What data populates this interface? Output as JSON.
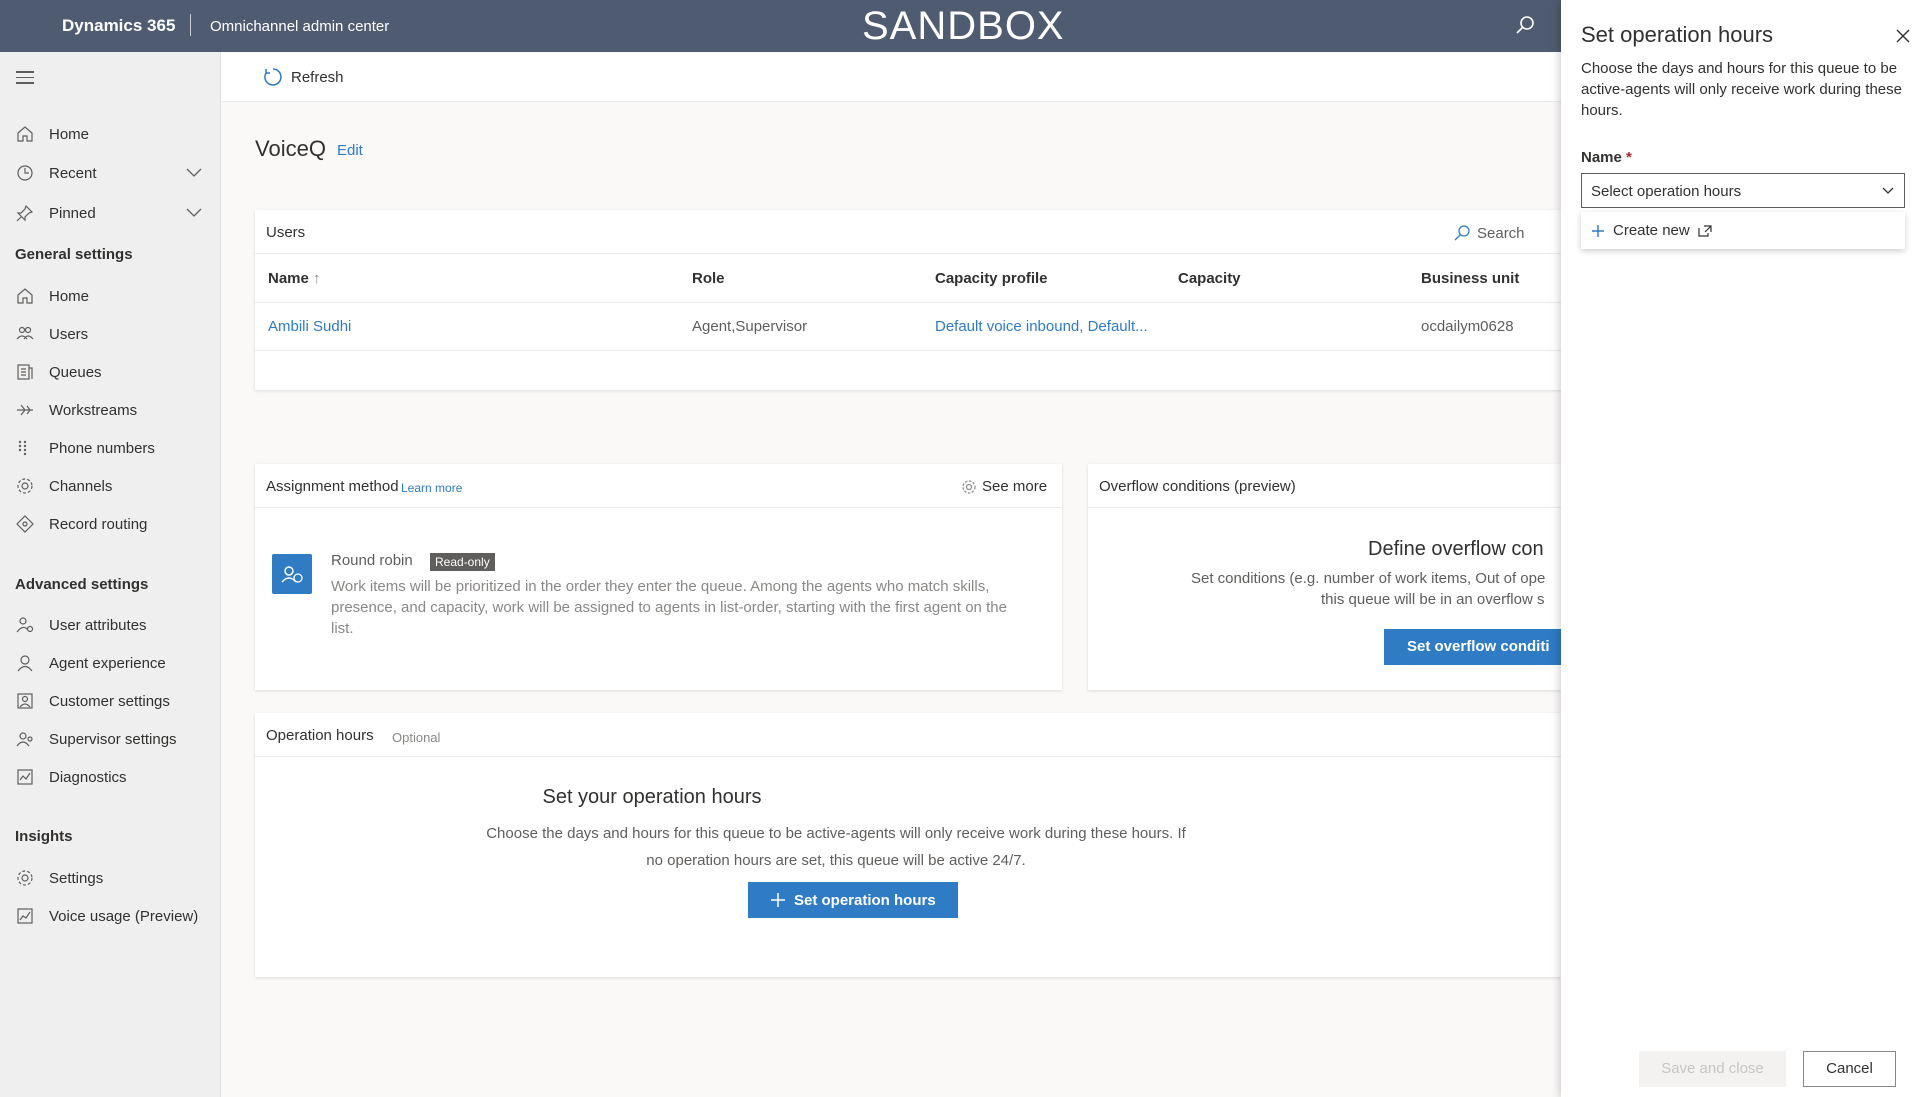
{
  "header": {
    "brand": "Dynamics 365",
    "app_name": "Omnichannel admin center",
    "environment": "SANDBOX"
  },
  "nav": {
    "top_items": [
      {
        "label": "Home",
        "icon": "home-icon"
      },
      {
        "label": "Recent",
        "icon": "clock-icon",
        "expandable": true
      },
      {
        "label": "Pinned",
        "icon": "pin-icon",
        "expandable": true
      }
    ],
    "general_settings_title": "General settings",
    "general_items": [
      {
        "label": "Home",
        "icon": "home-icon"
      },
      {
        "label": "Users",
        "icon": "users-icon"
      },
      {
        "label": "Queues",
        "icon": "queue-icon"
      },
      {
        "label": "Workstreams",
        "icon": "workstream-icon"
      },
      {
        "label": "Phone numbers",
        "icon": "dialpad-icon"
      },
      {
        "label": "Channels",
        "icon": "channel-gear-icon"
      },
      {
        "label": "Record routing",
        "icon": "routing-icon"
      }
    ],
    "advanced_settings_title": "Advanced settings",
    "advanced_items": [
      {
        "label": "User attributes",
        "icon": "user-attributes-icon"
      },
      {
        "label": "Agent experience",
        "icon": "agent-icon"
      },
      {
        "label": "Customer settings",
        "icon": "customer-icon"
      },
      {
        "label": "Supervisor settings",
        "icon": "supervisor-icon"
      },
      {
        "label": "Diagnostics",
        "icon": "diagnostics-icon"
      }
    ],
    "insights_title": "Insights",
    "insights_items": [
      {
        "label": "Settings",
        "icon": "settings-gear-icon"
      },
      {
        "label": "Voice usage (Preview)",
        "icon": "chart-icon"
      }
    ]
  },
  "commandbar": {
    "refresh_label": "Refresh"
  },
  "page": {
    "title": "VoiceQ",
    "edit_label": "Edit"
  },
  "users_card": {
    "title": "Users",
    "search_placeholder": "Search",
    "columns": [
      "Name",
      "Role",
      "Capacity profile",
      "Capacity",
      "Business unit"
    ],
    "sort_indicator": "↑",
    "rows": [
      {
        "name": "Ambili Sudhi",
        "role": "Agent,Supervisor",
        "capacity_profile": "Default voice inbound, Default...",
        "capacity": "",
        "business_unit": "ocdailym0628"
      }
    ]
  },
  "assignment_card": {
    "title": "Assignment method",
    "learn_more": "Learn more",
    "see_more": "See more",
    "method_name": "Round robin",
    "badge": "Read-only",
    "description": "Work items will be prioritized in the order they enter the queue. Among the agents who match skills, presence, and capacity, work will be assigned to agents in list-order, starting with the first agent on the list."
  },
  "overflow_card": {
    "title": "Overflow conditions (preview)",
    "heading": "Define overflow con",
    "desc_line1": "Set conditions (e.g. number of work items, Out of ope",
    "desc_line2": "this queue will be in an overflow s",
    "button": "Set overflow conditi"
  },
  "operation_hours_card": {
    "title": "Operation hours",
    "optional": "Optional",
    "heading": "Set your operation hours",
    "description": "Choose the days and hours for this queue to be active-agents will only receive work during these hours. If no operation hours are set, this queue will be active 24/7.",
    "button": "Set operation hours"
  },
  "panel": {
    "title": "Set operation hours",
    "description": "Choose the days and hours for this queue to be active-agents will only receive work during these hours.",
    "field_label": "Name",
    "required_mark": "*",
    "select_placeholder": "Select operation hours",
    "dropdown_option": "Create new",
    "save_button": "Save and close",
    "cancel_button": "Cancel"
  },
  "colors": {
    "header_bg": "#4f5b70",
    "accent": "#2f7bc4",
    "nav_bg": "#efefef"
  }
}
